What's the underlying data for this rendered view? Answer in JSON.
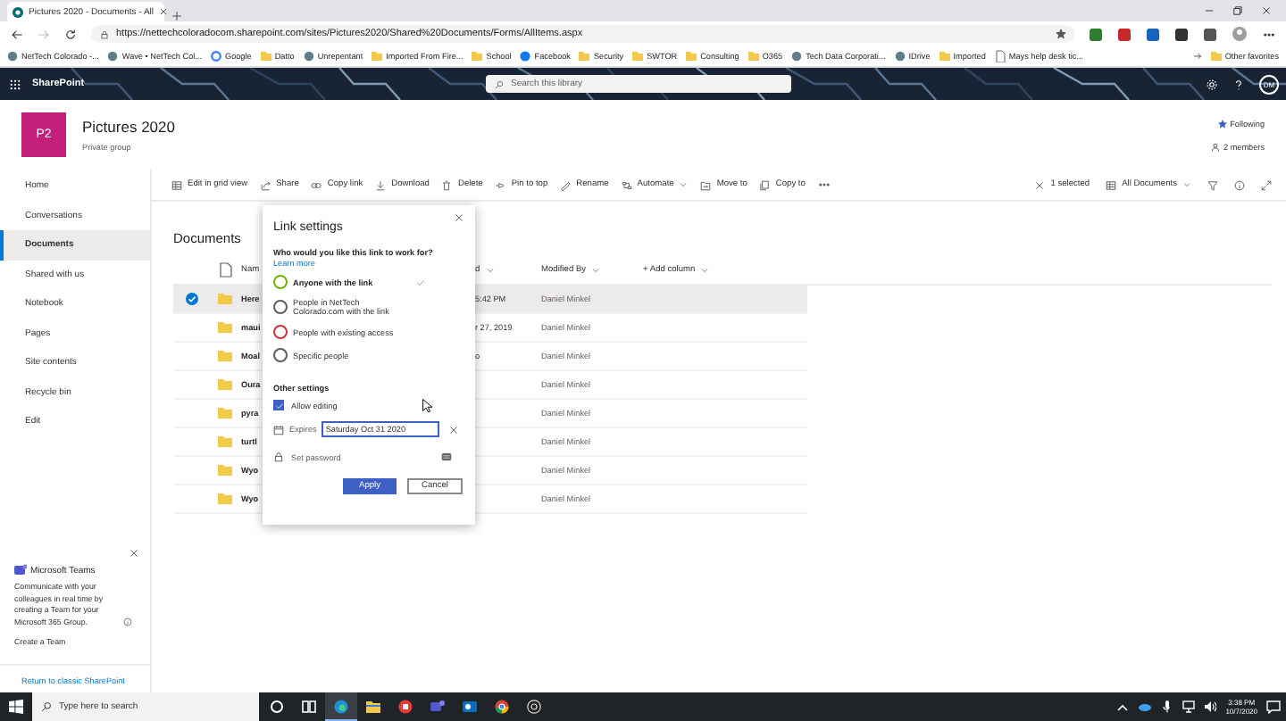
{
  "browser": {
    "tabs": [
      {
        "title": "Pictures 2020 - Documents - All",
        "selected": true
      }
    ],
    "url": "https://nettechcoloradocom.sharepoint.com/sites/Pictures2020/Shared%20Documents/Forms/AllItems.aspx",
    "bookmarks": [
      {
        "label": "NetTech Colorado -...",
        "kind": "site"
      },
      {
        "label": "Wave • NetTech Col...",
        "kind": "site"
      },
      {
        "label": "Google",
        "kind": "google"
      },
      {
        "label": "Datto",
        "kind": "folder"
      },
      {
        "label": "Unrepentant",
        "kind": "site"
      },
      {
        "label": "Imported From Fire...",
        "kind": "folder"
      },
      {
        "label": "School",
        "kind": "folder"
      },
      {
        "label": "Facebook",
        "kind": "facebook"
      },
      {
        "label": "Security",
        "kind": "folder"
      },
      {
        "label": "SWTOR",
        "kind": "folder"
      },
      {
        "label": "Consulting",
        "kind": "folder"
      },
      {
        "label": "O365",
        "kind": "folder"
      },
      {
        "label": "Tech Data Corporati...",
        "kind": "site"
      },
      {
        "label": "IDrive",
        "kind": "site"
      },
      {
        "label": "Imported",
        "kind": "folder"
      },
      {
        "label": "Mays help desk tic...",
        "kind": "page"
      }
    ],
    "other_favorites": "Other favorites"
  },
  "suite_bar": {
    "app": "SharePoint",
    "search_placeholder": "Search this library",
    "avatar": "DM"
  },
  "site": {
    "logo": "P2",
    "title": "Pictures 2020",
    "subtitle": "Private group",
    "following": "Following",
    "members": "2 members"
  },
  "nav": [
    {
      "label": "Home",
      "selected": false
    },
    {
      "label": "Conversations",
      "selected": false
    },
    {
      "label": "Documents",
      "selected": true
    },
    {
      "label": "Shared with us",
      "selected": false
    },
    {
      "label": "Notebook",
      "selected": false
    },
    {
      "label": "Pages",
      "selected": false
    },
    {
      "label": "Site contents",
      "selected": false
    },
    {
      "label": "Recycle bin",
      "selected": false
    },
    {
      "label": "Edit",
      "selected": false
    }
  ],
  "teams_card": {
    "title": "Microsoft Teams",
    "text": "Communicate with your colleagues in real time by creating a Team for your Microsoft 365 Group.",
    "link": "Create a Team"
  },
  "classic_link": "Return to classic SharePoint",
  "commands": [
    {
      "label": "Edit in grid view",
      "kind": "grid"
    },
    {
      "label": "Share",
      "kind": "share"
    },
    {
      "label": "Copy link",
      "kind": "link"
    },
    {
      "label": "Download",
      "kind": "download"
    },
    {
      "label": "Delete",
      "kind": "delete"
    },
    {
      "label": "Pin to top",
      "kind": "pin"
    },
    {
      "label": "Rename",
      "kind": "rename"
    },
    {
      "label": "Automate",
      "kind": "automate",
      "menu": true
    },
    {
      "label": "Move to",
      "kind": "move"
    },
    {
      "label": "Copy to",
      "kind": "copy"
    }
  ],
  "view": {
    "selection": "1 selected",
    "view_name": "All Documents"
  },
  "library": {
    "title": "Documents",
    "columns": [
      {
        "label": "Nam"
      },
      {
        "label": "d"
      },
      {
        "label": "Modified By"
      },
      {
        "label": "+ Add column"
      }
    ],
    "rows": [
      {
        "name": "Here",
        "modified": "5:42 PM",
        "modified_by": "Daniel Minkel",
        "selected": true
      },
      {
        "name": "maui",
        "modified": "r 27, 2019",
        "modified_by": "Daniel Minkel",
        "selected": false
      },
      {
        "name": "Moal",
        "modified": "o",
        "modified_by": "Daniel Minkel",
        "selected": false
      },
      {
        "name": "Oura",
        "modified_by": "Daniel Minkel",
        "selected": false
      },
      {
        "name": "pyra",
        "modified_by": "Daniel Minkel",
        "selected": false
      },
      {
        "name": "turtl",
        "modified_by": "Daniel Minkel",
        "selected": false
      },
      {
        "name": "Wyo",
        "modified_by": "Daniel Minkel",
        "selected": false
      },
      {
        "name": "Wyo",
        "modified_by": "Daniel Minkel",
        "selected": false
      }
    ]
  },
  "dialog": {
    "title": "Link settings",
    "question": "Who would you like this link to work for?",
    "learn_more": "Learn more",
    "options": [
      {
        "label": "Anyone with the link",
        "selected": true,
        "color": "#6bb700"
      },
      {
        "label": "People in NetTech Colorado.com with the link",
        "selected": false,
        "color": "#605e5c"
      },
      {
        "label": "People with existing access",
        "selected": false,
        "color": "#d13438"
      },
      {
        "label": "Specific people",
        "selected": false,
        "color": "#605e5c"
      }
    ],
    "other_settings": "Other settings",
    "allow_editing": {
      "label": "Allow editing",
      "checked": true
    },
    "expires": {
      "label": "Expires",
      "value": "Saturday Oct 31 2020"
    },
    "password": {
      "placeholder": "Set password"
    },
    "apply": "Apply",
    "cancel": "Cancel"
  },
  "taskbar": {
    "search_placeholder": "Type here to search",
    "apps": [
      {
        "kind": "cortana",
        "active": false
      },
      {
        "kind": "taskview",
        "active": false
      },
      {
        "kind": "edge",
        "active": true
      },
      {
        "kind": "explorer",
        "active": false
      },
      {
        "kind": "redapp",
        "active": false
      },
      {
        "kind": "teams",
        "active": false
      },
      {
        "kind": "outlook",
        "active": false
      },
      {
        "kind": "chrome",
        "active": false
      },
      {
        "kind": "obs",
        "active": false
      }
    ],
    "time": "3:38 PM",
    "date": "10/7/2020"
  }
}
